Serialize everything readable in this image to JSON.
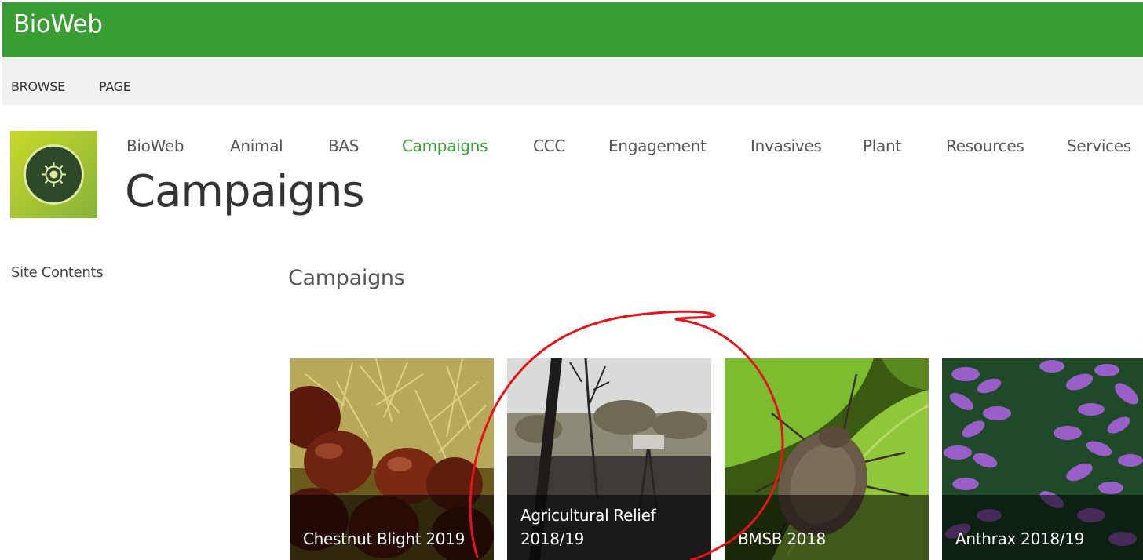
{
  "suite_bar": {
    "title": "BioWeb",
    "color": "#389e34"
  },
  "ribbon": {
    "tabs": [
      {
        "label": "BROWSE"
      },
      {
        "label": "PAGE"
      }
    ]
  },
  "site": {
    "logo_icon": "site-logo-icon",
    "nav": [
      {
        "label": "BioWeb"
      },
      {
        "label": "Animal"
      },
      {
        "label": "BAS"
      },
      {
        "label": "Campaigns",
        "selected": true
      },
      {
        "label": "CCC"
      },
      {
        "label": "Engagement"
      },
      {
        "label": "Invasives"
      },
      {
        "label": "Plant"
      },
      {
        "label": "Resources"
      },
      {
        "label": "Services"
      }
    ],
    "page_title": "Campaigns",
    "selected_color": "#389e34"
  },
  "quick_launch": {
    "site_contents": "Site Contents"
  },
  "main": {
    "webpart_title": "Campaigns",
    "tiles": [
      {
        "label": "Chestnut Blight 2019",
        "image": "chestnuts-photo"
      },
      {
        "label_line1": "Agricultural Relief",
        "label_line2": "2018/19",
        "image": "burnt-farmland-photo"
      },
      {
        "label": "BMSB 2018",
        "image": "stink-bug-on-leaf-photo"
      },
      {
        "label": "Anthrax 2018/19",
        "image": "anthrax-bacteria-photo"
      }
    ]
  },
  "annotation": {
    "shape": "red-freehand-circle",
    "color": "#e3151a"
  }
}
